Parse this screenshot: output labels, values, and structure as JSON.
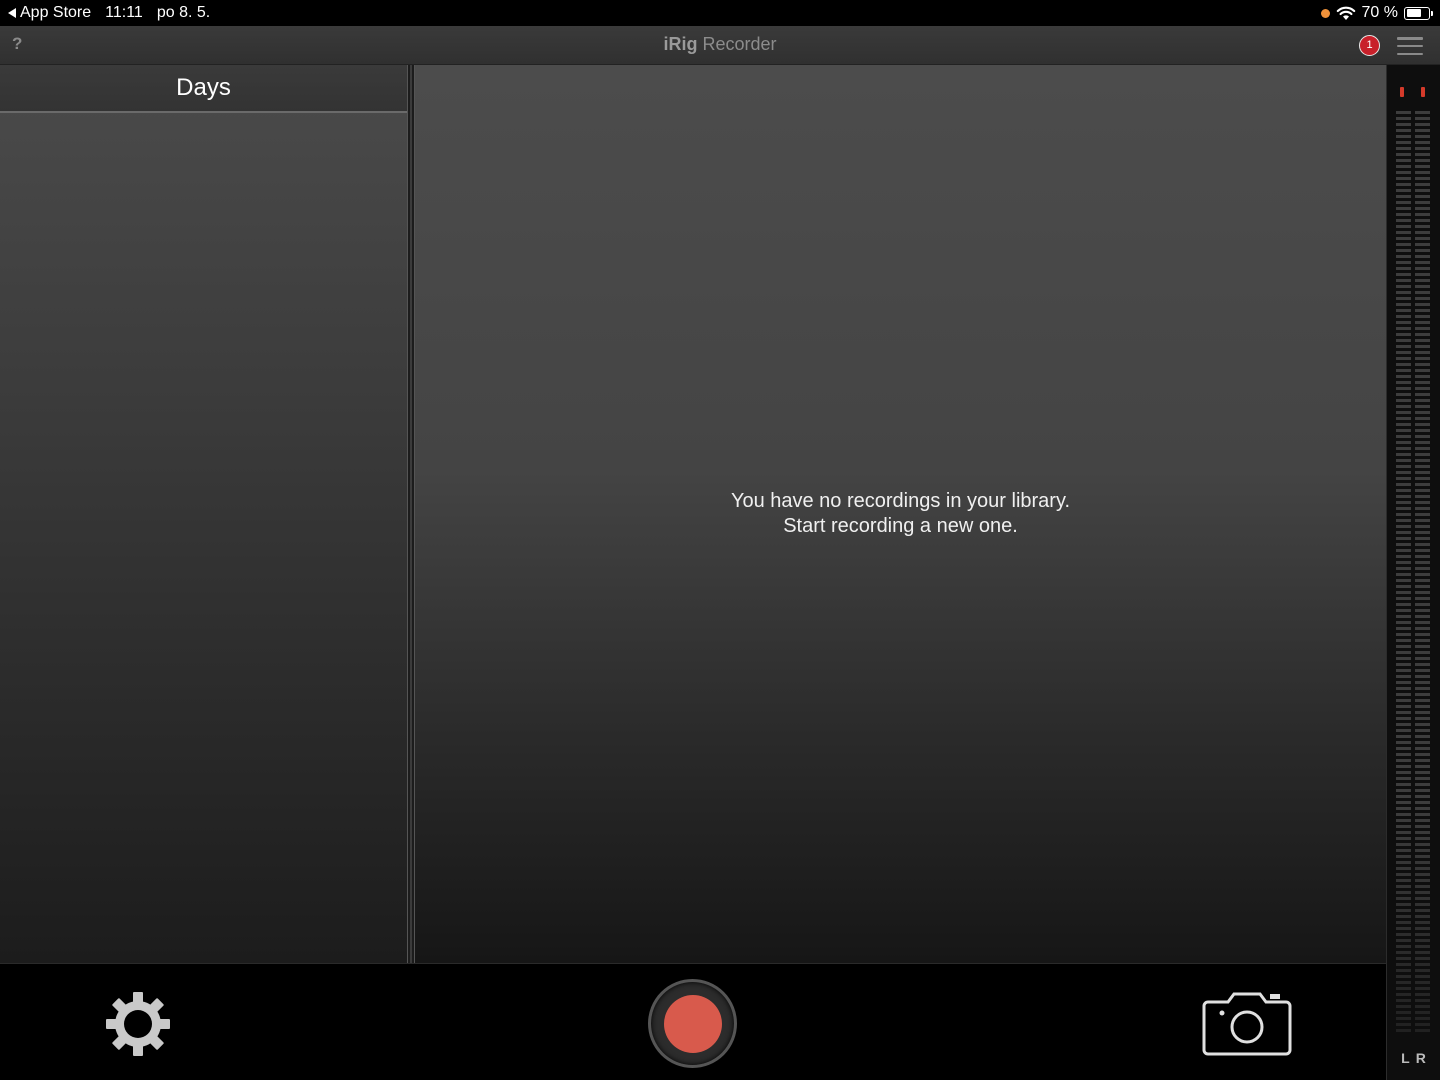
{
  "status_bar": {
    "back_label": "App Store",
    "time": "11:11",
    "date": "po 8. 5.",
    "battery_text": "70 %",
    "battery_level": 0.7
  },
  "header": {
    "help_label": "?",
    "title_bold": "iRig",
    "title_rest": " Recorder",
    "notification_count": "1"
  },
  "sidebar": {
    "title": "Days"
  },
  "library": {
    "empty_line1": "You have no recordings in your library.",
    "empty_line2": "Start recording a new one."
  },
  "meter": {
    "channels": "LR",
    "left_label": "L",
    "right_label": "R"
  },
  "colors": {
    "record": "#d85a4c",
    "peak": "#d43a2a",
    "badge": "#c8202a"
  },
  "icons": {
    "settings": "gear-icon",
    "record": "record-icon",
    "camera": "camera-icon",
    "menu": "hamburger-icon"
  }
}
